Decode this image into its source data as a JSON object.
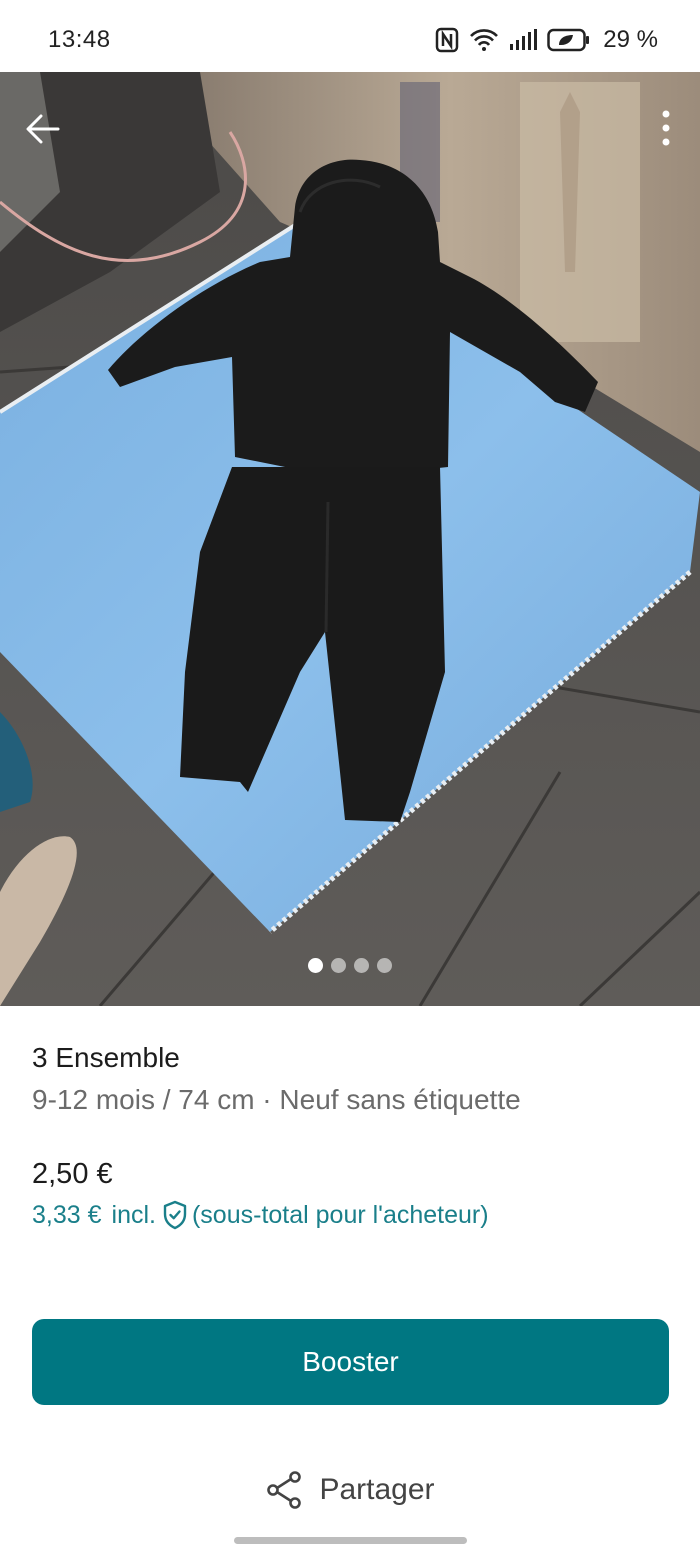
{
  "status_bar": {
    "time": "13:48",
    "battery_percent": "29 %",
    "icons": [
      "nfc-icon",
      "wifi-icon",
      "signal-icon",
      "battery-icon"
    ]
  },
  "photo": {
    "description_icons": [
      "back-arrow-icon",
      "more-vertical-icon"
    ],
    "carousel": {
      "total": 4,
      "active_index": 0
    }
  },
  "item": {
    "title": "3 Ensemble",
    "details": "9-12 mois / 74 cm · Neuf sans étiquette",
    "price": "2,50 €",
    "buyer_price": "3,33 €",
    "buyer_incl": "incl.",
    "buyer_note": "(sous-total pour l'acheteur)"
  },
  "actions": {
    "booster_label": "Booster",
    "share_label": "Partager"
  },
  "colors": {
    "accent": "#007782",
    "accent_text": "#1a7f8a"
  }
}
